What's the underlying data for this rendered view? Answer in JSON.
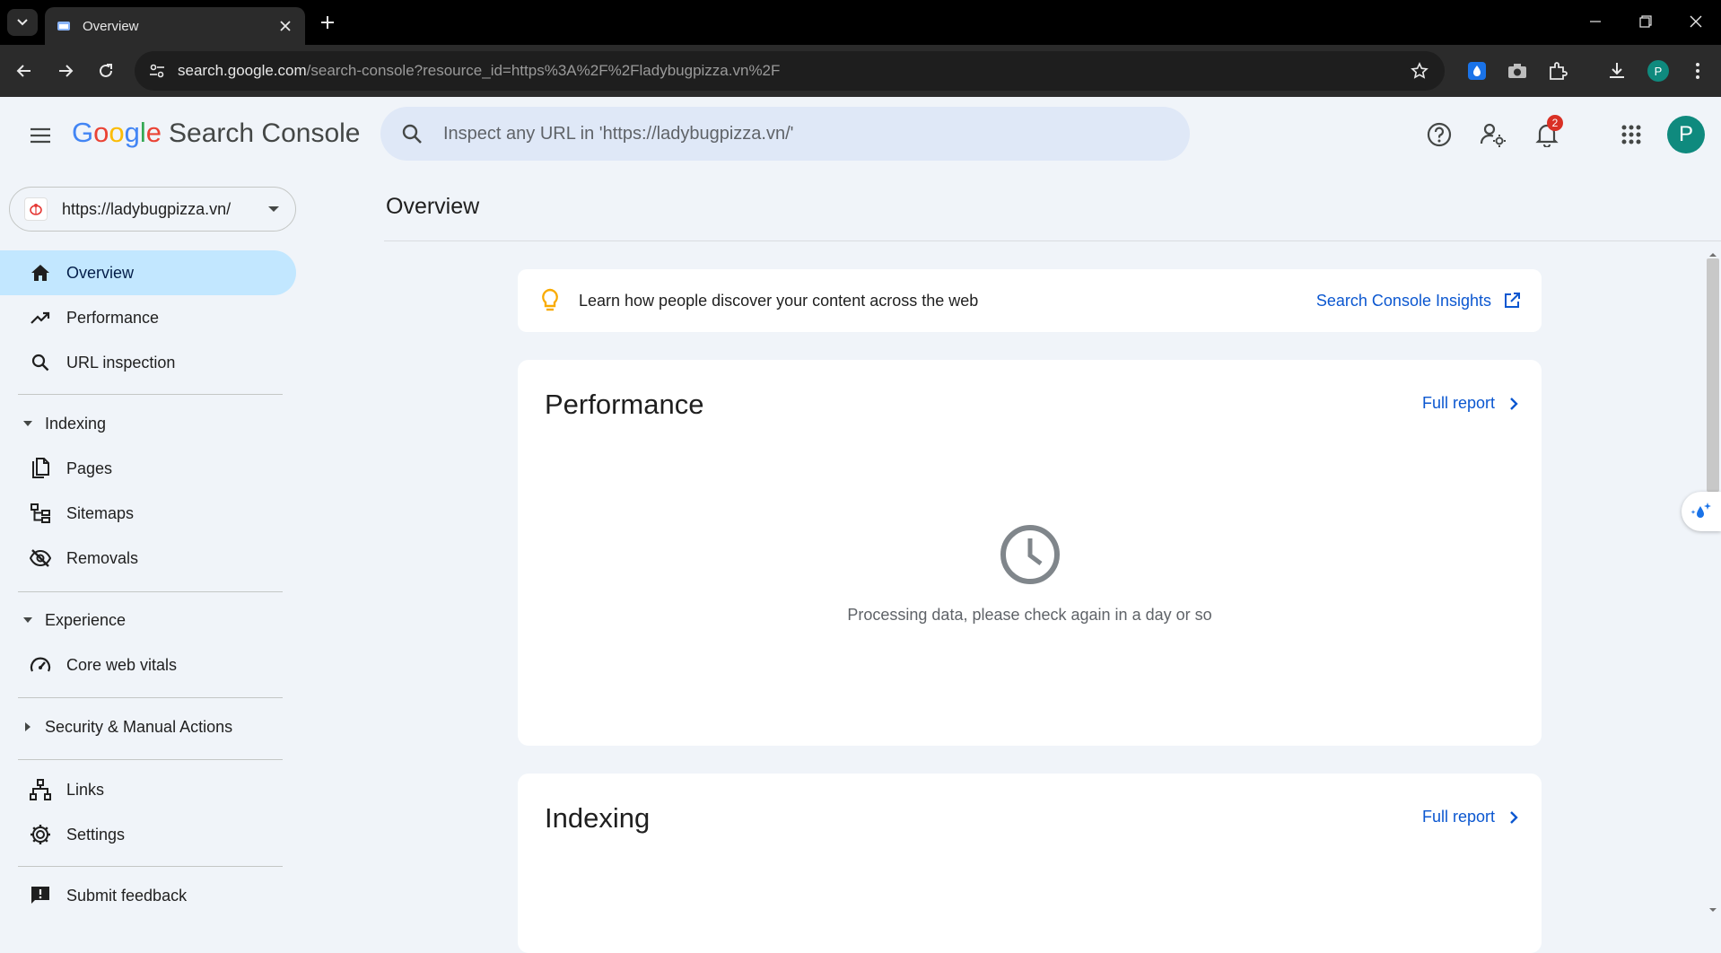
{
  "browser": {
    "tab_title": "Overview",
    "url_host": "search.google.com",
    "url_path": "/search-console?resource_id=https%3A%2F%2Fladybugpizza.vn%2F",
    "profile_initial": "P"
  },
  "header": {
    "logo_letters": [
      "G",
      "o",
      "o",
      "g",
      "l",
      "e"
    ],
    "product_name": "Search Console",
    "search_placeholder": "Inspect any URL in 'https://ladybugpizza.vn/'",
    "notification_count": "2",
    "avatar_initial": "P"
  },
  "sidebar": {
    "property_url": "https://ladybugpizza.vn/",
    "top_items": [
      {
        "label": "Overview",
        "icon": "home-icon",
        "active": true
      },
      {
        "label": "Performance",
        "icon": "trending-up-icon"
      },
      {
        "label": "URL inspection",
        "icon": "search-icon"
      }
    ],
    "sections": [
      {
        "label": "Indexing",
        "expanded": true,
        "items": [
          {
            "label": "Pages",
            "icon": "pages-icon"
          },
          {
            "label": "Sitemaps",
            "icon": "sitemap-icon"
          },
          {
            "label": "Removals",
            "icon": "visibility-off-icon"
          }
        ]
      },
      {
        "label": "Experience",
        "expanded": true,
        "items": [
          {
            "label": "Core web vitals",
            "icon": "speed-icon"
          }
        ]
      },
      {
        "label": "Security & Manual Actions",
        "expanded": false,
        "items": []
      }
    ],
    "bottom_items": [
      {
        "label": "Links",
        "icon": "links-icon"
      },
      {
        "label": "Settings",
        "icon": "gear-icon"
      }
    ],
    "feedback_label": "Submit feedback"
  },
  "main": {
    "title": "Overview",
    "insight_text": "Learn how people discover your content across the web",
    "insight_link": "Search Console Insights",
    "performance_card": {
      "title": "Performance",
      "link": "Full report",
      "processing_text": "Processing data, please check again in a day or so"
    },
    "indexing_card": {
      "title": "Indexing",
      "link": "Full report"
    }
  },
  "colors": {
    "accent": "#0b57d0",
    "active_nav": "#c2e7ff",
    "page_bg": "#f0f4f9",
    "avatar": "#0f8a7e"
  }
}
